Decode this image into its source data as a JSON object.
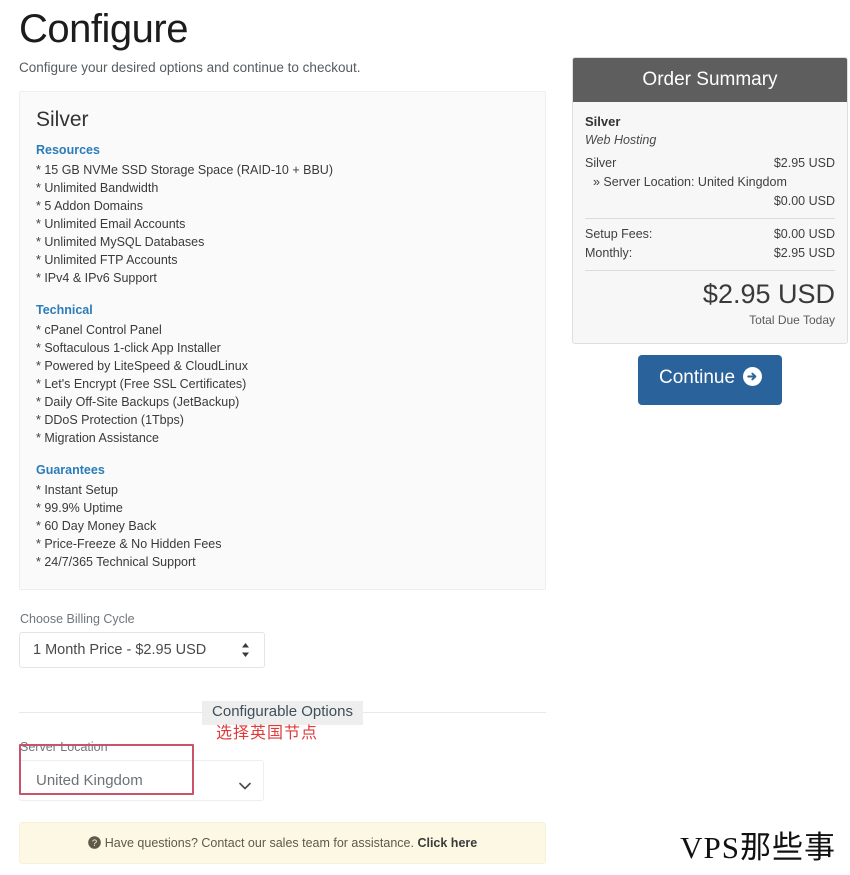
{
  "page": {
    "title": "Configure",
    "subtitle": "Configure your desired options and continue to checkout."
  },
  "package": {
    "name": "Silver",
    "groups": [
      {
        "heading": "Resources",
        "lines": [
          "* 15 GB NVMe SSD Storage Space (RAID-10 + BBU)",
          "* Unlimited Bandwidth",
          "* 5 Addon Domains",
          "* Unlimited Email Accounts",
          "* Unlimited MySQL Databases",
          "* Unlimited FTP Accounts",
          "* IPv4 & IPv6 Support"
        ]
      },
      {
        "heading": "Technical",
        "lines": [
          "* cPanel Control Panel",
          "* Softaculous 1-click App Installer",
          "* Powered by LiteSpeed & CloudLinux",
          "* Let's Encrypt (Free SSL Certificates)",
          "* Daily Off-Site Backups (JetBackup)",
          "* DDoS Protection (1Tbps)",
          "* Migration Assistance"
        ]
      },
      {
        "heading": "Guarantees",
        "lines": [
          "* Instant Setup",
          "* 99.9% Uptime",
          "* 60 Day Money Back",
          "* Price-Freeze & No Hidden Fees",
          "* 24/7/365 Technical Support"
        ]
      }
    ]
  },
  "billing": {
    "label": "Choose Billing Cycle",
    "selected": "1 Month Price - $2.95 USD",
    "icon": "up-down-chevron-icon"
  },
  "configurable_options": {
    "divider_label": "Configurable Options",
    "server_location": {
      "label": "Server Location",
      "selected": "United Kingdom",
      "icon": "chevron-down-icon"
    }
  },
  "annotation": {
    "text": "选择英国节点",
    "color": "#e03a3a",
    "rect_color": "#c9546a"
  },
  "help_alert": {
    "icon": "question-circle-icon",
    "text": "Have questions? Contact our sales team for assistance.",
    "link_label": "Click here"
  },
  "order_summary": {
    "heading": "Order Summary",
    "header_color": "#5e5e5e",
    "product_name": "Silver",
    "product_group": "Web Hosting",
    "line_items": [
      {
        "label": "Silver",
        "price": "$2.95 USD"
      }
    ],
    "suboption": {
      "label": "» Server Location: United Kingdom",
      "price": "$0.00 USD"
    },
    "fees": [
      {
        "label": "Setup Fees:",
        "price": "$0.00 USD"
      },
      {
        "label": "Monthly:",
        "price": "$2.95 USD"
      }
    ],
    "total_amount": "$2.95 USD",
    "total_label": "Total Due Today"
  },
  "continue": {
    "label": "Continue",
    "icon": "arrow-circle-right-icon",
    "color": "#2a639c"
  },
  "watermark": {
    "text": "VPS那些事"
  }
}
